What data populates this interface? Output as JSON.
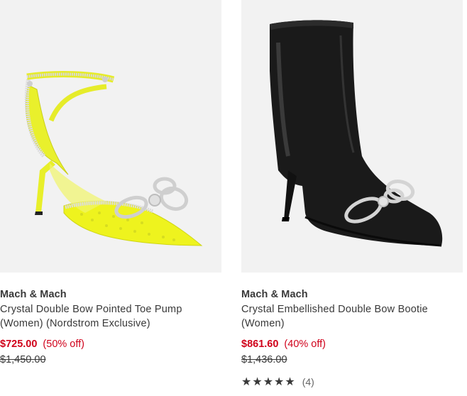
{
  "products": [
    {
      "brand": "Mach & Mach",
      "title_line1": "Crystal Double Bow Pointed Toe Pump",
      "title_line2": "(Women) (Nordstrom Exclusive)",
      "sale_price": "$725.00",
      "discount": "(50% off)",
      "original_price": "$1,450.00",
      "image_icon": "yellow-pump-shoe-image"
    },
    {
      "brand": "Mach & Mach",
      "title_line1": "Crystal Embellished Double Bow Bootie",
      "title_line2": "(Women)",
      "sale_price": "$861.60",
      "discount": "(40% off)",
      "original_price": "$1,436.00",
      "rating_stars": 5,
      "review_count": "(4)",
      "image_icon": "black-bootie-image"
    }
  ],
  "colors": {
    "sale": "#d0021b",
    "text": "#393939",
    "image_bg": "#f2f2f2"
  }
}
